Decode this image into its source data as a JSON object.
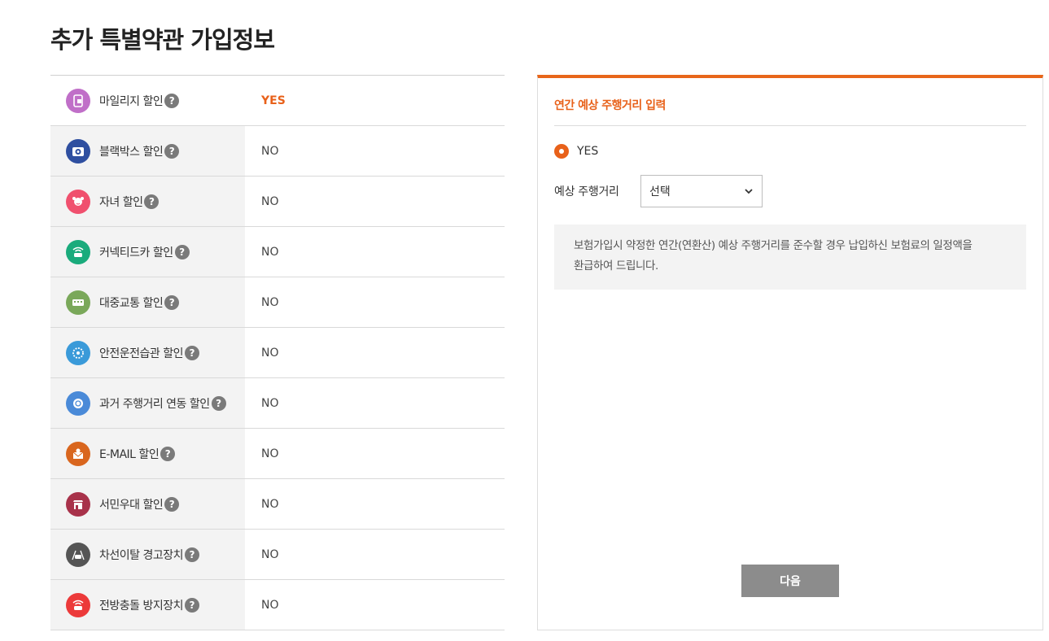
{
  "page": {
    "title": "추가 특별약관 가입정보"
  },
  "discounts": [
    {
      "icon": "mileage-icon",
      "label": "마일리지 할인",
      "value": "YES",
      "icon_color": "#c06fc8"
    },
    {
      "icon": "blackbox-icon",
      "label": "블랙박스 할인",
      "value": "NO",
      "icon_color": "#2f4fa0"
    },
    {
      "icon": "child-icon",
      "label": "자녀 할인",
      "value": "NO",
      "icon_color": "#f0506e"
    },
    {
      "icon": "connected-car-icon",
      "label": "커넥티드카 할인",
      "value": "NO",
      "icon_color": "#1aab7c"
    },
    {
      "icon": "bus-icon",
      "label": "대중교통 할인",
      "value": "NO",
      "icon_color": "#7aa85a"
    },
    {
      "icon": "safe-driving-icon",
      "label": "안전운전습관 할인",
      "value": "NO",
      "icon_color": "#3a9ad9"
    },
    {
      "icon": "past-mileage-icon",
      "label": "과거 주행거리 연동 할인",
      "value": "NO",
      "icon_color": "#4a8ad8"
    },
    {
      "icon": "email-icon",
      "label": "E-MAIL 할인",
      "value": "NO",
      "icon_color": "#d9661e"
    },
    {
      "icon": "store-icon",
      "label": "서민우대 할인",
      "value": "NO",
      "icon_color": "#a8324a"
    },
    {
      "icon": "lane-departure-icon",
      "label": "차선이탈 경고장치",
      "value": "NO",
      "icon_color": "#555555"
    },
    {
      "icon": "collision-icon",
      "label": "전방충돌 방지장치",
      "value": "NO",
      "icon_color": "#ec3a3a"
    }
  ],
  "help_glyph": "?",
  "panel": {
    "title": "연간 예상 주행거리 입력",
    "radio_label": "YES",
    "distance_label": "예상 주행거리",
    "select_value": "선택",
    "notice_line1": "보험가입시 약정한 연간(연환산) 예상 주행거리를 준수할 경우 납입하신 보험료의 일정액을",
    "notice_line2": "환급하여 드립니다.",
    "next_button": "다음"
  },
  "colors": {
    "accent": "#e8611a",
    "button": "#8c8c8c"
  }
}
